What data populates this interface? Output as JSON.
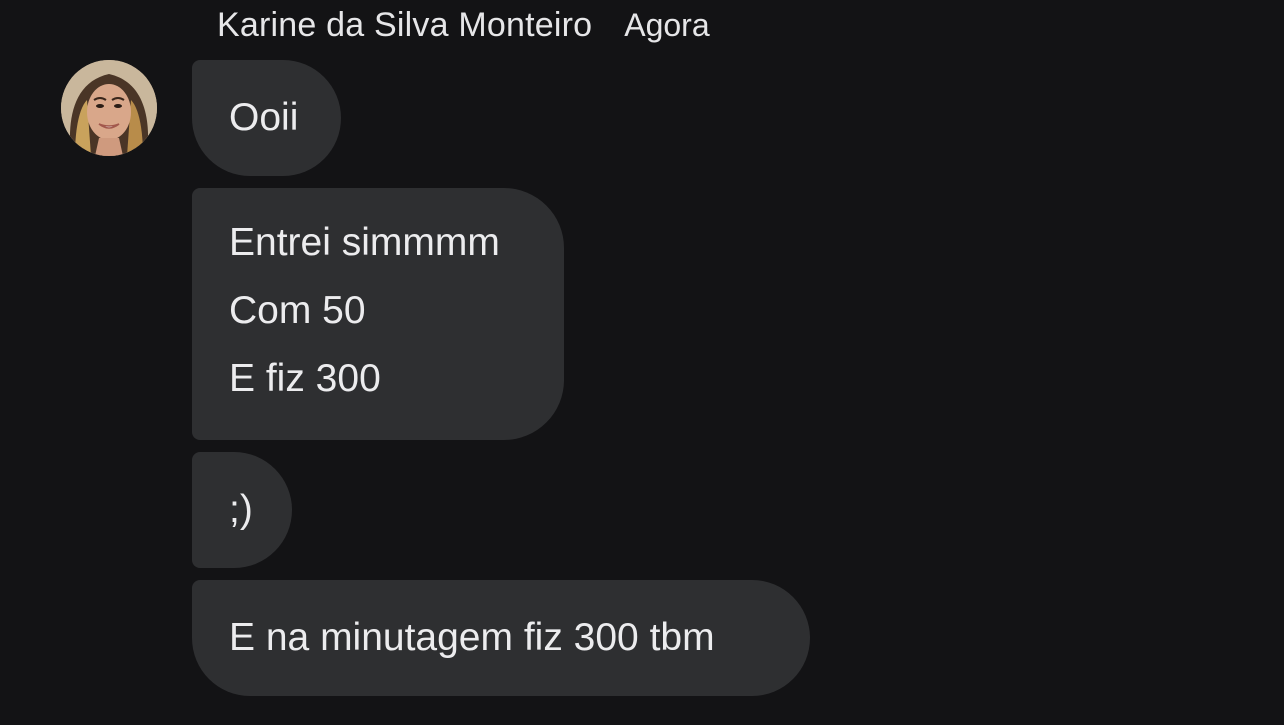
{
  "conversation": {
    "sender_name": "Karine da Silva Monteiro",
    "timestamp": "Agora",
    "avatar": "profile-photo"
  },
  "messages": [
    {
      "lines": [
        "Ooii"
      ]
    },
    {
      "lines": [
        "Entrei simmmm",
        "Com 50",
        "E fiz 300"
      ]
    },
    {
      "lines": [
        ";)"
      ]
    },
    {
      "lines": [
        "E na minutagem fiz 300 tbm"
      ]
    }
  ],
  "colors": {
    "background": "#131315",
    "bubble": "#2e2f31",
    "text": "#ececee"
  }
}
